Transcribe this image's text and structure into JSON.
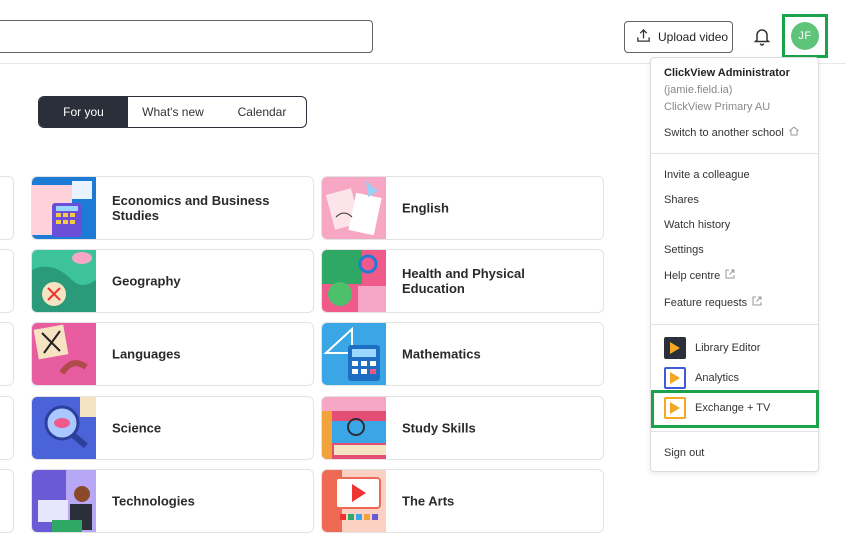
{
  "header": {
    "search_placeholder": "",
    "upload_label": "Upload video",
    "avatar_initials": "JF"
  },
  "tabs": [
    {
      "label": "For you",
      "active": true
    },
    {
      "label": "What's new",
      "active": false
    },
    {
      "label": "Calendar",
      "active": false
    }
  ],
  "subjects": [
    {
      "label": "Economics and Business Studies",
      "thumb_color": "#1d7bd6"
    },
    {
      "label": "English",
      "thumb_color": "#f7a6c4"
    },
    {
      "label": "Geography",
      "thumb_color": "#3cc39a"
    },
    {
      "label": "Health and Physical Education",
      "thumb_color": "#f05a8a"
    },
    {
      "label": "Languages",
      "thumb_color": "#e85ca0"
    },
    {
      "label": "Mathematics",
      "thumb_color": "#3aa6e6"
    },
    {
      "label": "Science",
      "thumb_color": "#4a63d8"
    },
    {
      "label": "Study Skills",
      "thumb_color": "#e44d74"
    },
    {
      "label": "Technologies",
      "thumb_color": "#6b5ad6"
    },
    {
      "label": "The Arts",
      "thumb_color": "#ef6a55"
    }
  ],
  "menu": {
    "user_name": "ClickView Administrator",
    "user_handle": "(jamie.field.ia)",
    "org": "ClickView Primary AU",
    "switch_school": "Switch to another school",
    "links": [
      "Invite a colleague",
      "Shares",
      "Watch history",
      "Settings",
      "Help centre",
      "Feature requests"
    ],
    "apps": [
      {
        "label": "Library Editor",
        "color": "#2b2f3a"
      },
      {
        "label": "Analytics",
        "color": "#3f5bd9"
      },
      {
        "label": "Exchange + TV",
        "color": "#f5a623"
      }
    ],
    "sign_out": "Sign out"
  },
  "colors": {
    "highlight": "#1aa34a",
    "play_orange": "#f5a623"
  }
}
